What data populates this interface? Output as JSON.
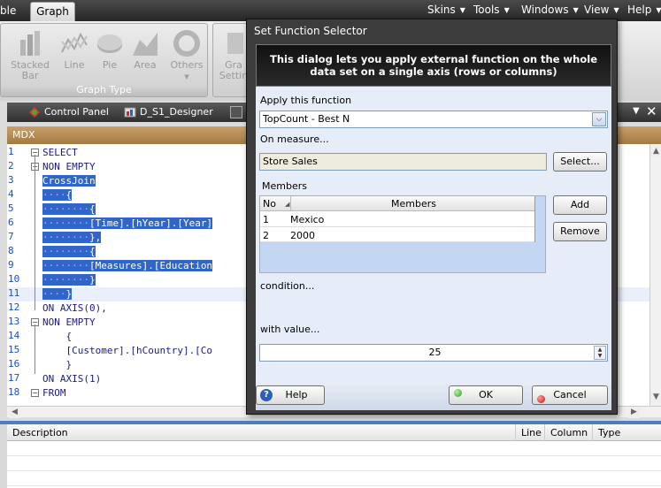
{
  "menubar": {
    "left_tab": "ble",
    "active_tab": "Graph",
    "menus": [
      "Skins",
      "Tools",
      "Windows",
      "View",
      "Help"
    ]
  },
  "ribbon": {
    "buttons": [
      {
        "label": "Stacked\nBar",
        "icon": "stacked-bar-icon"
      },
      {
        "label": "Line",
        "icon": "line-chart-icon"
      },
      {
        "label": "Pie",
        "icon": "pie-chart-icon"
      },
      {
        "label": "Area",
        "icon": "area-chart-icon"
      },
      {
        "label": "Others",
        "icon": "others-chart-icon"
      }
    ],
    "group_label": "Graph Type",
    "partial_button": "Gra\nSettin"
  },
  "doc_tabs": [
    {
      "label": "Control Panel",
      "icon": "control-panel-icon"
    },
    {
      "label": "D_S1_Designer",
      "icon": "designer-icon"
    }
  ],
  "editor": {
    "header": "MDX",
    "lines": [
      {
        "n": "1",
        "text": "SELECT"
      },
      {
        "n": "2",
        "text": "NON EMPTY"
      },
      {
        "n": "3",
        "text": "CrossJoin"
      },
      {
        "n": "4",
        "text": "····{"
      },
      {
        "n": "5",
        "text": "········{"
      },
      {
        "n": "6",
        "text": "········[Time].[hYear].[Year]"
      },
      {
        "n": "7",
        "text": "········},"
      },
      {
        "n": "8",
        "text": "········{"
      },
      {
        "n": "9",
        "text": "········[Measures].[Education"
      },
      {
        "n": "10",
        "text": "········}"
      },
      {
        "n": "11",
        "text": "····}"
      },
      {
        "n": "12",
        "text": "ON AXIS(0),"
      },
      {
        "n": "13",
        "text": "NON EMPTY"
      },
      {
        "n": "14",
        "text": "    {"
      },
      {
        "n": "15",
        "text": "    [Customer].[hCountry].[Co"
      },
      {
        "n": "16",
        "text": "    }"
      },
      {
        "n": "17",
        "text": "ON AXIS(1)"
      },
      {
        "n": "18",
        "text": "FROM"
      }
    ]
  },
  "errors": {
    "columns": [
      "Description",
      "Line",
      "Column",
      "Type"
    ]
  },
  "dialog": {
    "title": "Set Function Selector",
    "banner": "This dialog lets you apply external function on the whole data set on a single axis (rows or columns)",
    "apply_label": "Apply this function",
    "function_value": "TopCount - Best N",
    "measure_label": "On measure...",
    "measure_value": "Store Sales",
    "select_btn": "Select...",
    "members_label": "Members",
    "members_table": {
      "headers": [
        "No",
        "Members"
      ],
      "rows": [
        [
          "1",
          "Mexico"
        ],
        [
          "2",
          "2000"
        ]
      ]
    },
    "add_btn": "Add",
    "remove_btn": "Remove",
    "condition_label": "condition...",
    "value_label": "with value...",
    "value": "25",
    "help_btn": "Help",
    "ok_btn": "OK",
    "cancel_btn": "Cancel"
  }
}
